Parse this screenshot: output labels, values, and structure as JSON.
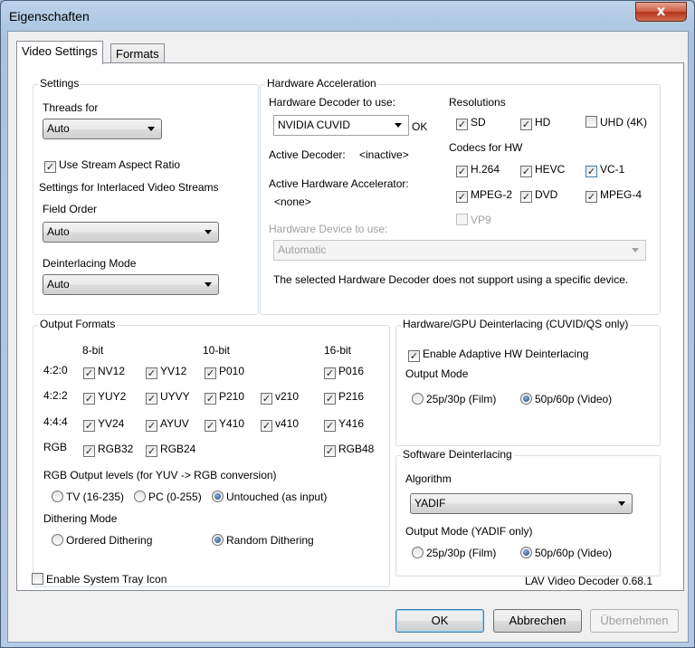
{
  "window": {
    "title": "Eigenschaften",
    "close_glyph": "x"
  },
  "tabs": [
    {
      "label": "Video Settings"
    },
    {
      "label": "Formats"
    }
  ],
  "settings": {
    "title": "Settings",
    "threads_label": "Threads for",
    "threads_value": "Auto",
    "aspect_label": "Use Stream Aspect Ratio",
    "interlaced_label": "Settings for Interlaced Video Streams",
    "field_order_label": "Field Order",
    "field_order_value": "Auto",
    "deint_mode_label": "Deinterlacing Mode",
    "deint_mode_value": "Auto"
  },
  "hwaccel": {
    "title": "Hardware Acceleration",
    "decoder_label": "Hardware Decoder to use:",
    "decoder_value": "NVIDIA CUVID",
    "ok_label": "OK",
    "active_decoder_label": "Active Decoder:",
    "active_decoder_value": "<inactive>",
    "active_accel_label": "Active Hardware Accelerator:",
    "active_accel_value": "<none>",
    "device_label": "Hardware Device to use:",
    "device_value": "Automatic",
    "note": "The selected Hardware Decoder does not support using a specific device.",
    "resolutions_label": "Resolutions",
    "res_sd": "SD",
    "res_hd": "HD",
    "res_uhd": "UHD (4K)",
    "codecs_label": "Codecs for HW",
    "c_h264": "H.264",
    "c_hevc": "HEVC",
    "c_vc1": "VC-1",
    "c_mpeg2": "MPEG-2",
    "c_dvd": "DVD",
    "c_mpeg4": "MPEG-4",
    "c_vp9": "VP9"
  },
  "output": {
    "title": "Output Formats",
    "h_8bit": "8-bit",
    "h_10bit": "10-bit",
    "h_16bit": "16-bit",
    "r420": "4:2:0",
    "r422": "4:2:2",
    "r444": "4:4:4",
    "rrgb": "RGB",
    "nv12": "NV12",
    "yv12": "YV12",
    "p010": "P010",
    "p016": "P016",
    "yuy2": "YUY2",
    "uyvy": "UYVY",
    "p210": "P210",
    "v210": "v210",
    "p216": "P216",
    "yv24": "YV24",
    "ayuv": "AYUV",
    "y410": "Y410",
    "v410": "v410",
    "y416": "Y416",
    "rgb32": "RGB32",
    "rgb24": "RGB24",
    "rgb48": "RGB48",
    "levels_label": "RGB Output levels (for YUV -> RGB conversion)",
    "lv_tv": "TV (16-235)",
    "lv_pc": "PC (0-255)",
    "lv_untouched": "Untouched (as input)",
    "dither_label": "Dithering Mode",
    "dither_ordered": "Ordered Dithering",
    "dither_random": "Random Dithering"
  },
  "hwdeint": {
    "title": "Hardware/GPU Deinterlacing (CUVID/QS only)",
    "adaptive": "Enable Adaptive HW Deinterlacing",
    "mode_label": "Output Mode",
    "m25": "25p/30p (Film)",
    "m50": "50p/60p (Video)"
  },
  "swdeint": {
    "title": "Software Deinterlacing",
    "algo_label": "Algorithm",
    "algo_value": "YADIF",
    "mode_label": "Output Mode (YADIF only)",
    "m25": "25p/30p (Film)",
    "m50": "50p/60p (Video)"
  },
  "footer": {
    "tray_label": "Enable System Tray Icon",
    "version": "LAV Video Decoder 0.68.1"
  },
  "buttons": {
    "ok": "OK",
    "cancel": "Abbrechen",
    "apply": "Übernehmen"
  },
  "check_glyph": "✓"
}
